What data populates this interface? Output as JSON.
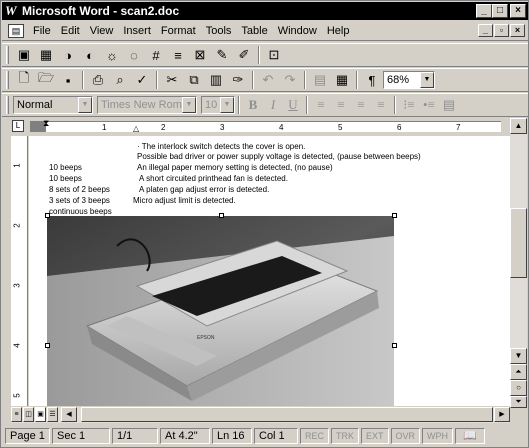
{
  "window": {
    "app_letter": "W",
    "title": "Microsoft Word - scan2.doc",
    "caption_buttons": [
      "_",
      "□",
      "×"
    ]
  },
  "menubar": {
    "items": [
      "File",
      "Edit",
      "View",
      "Insert",
      "Format",
      "Tools",
      "Table",
      "Window",
      "Help"
    ],
    "mdi_buttons": [
      "_",
      "▫",
      "×"
    ]
  },
  "toolbar_scan": {
    "icons": [
      "scan-icon",
      "picture-icon",
      "ocr-icon",
      "ocr-alt-icon",
      "brightness-icon",
      "contrast-icon",
      "crop-icon",
      "align-icon",
      "picture-frame-icon",
      "paint-icon",
      "pen-icon",
      "insert-picture-icon"
    ]
  },
  "toolbar_standard": {
    "zoom": "68%",
    "paragraph_mark": "¶"
  },
  "toolbar_formatting": {
    "style": "Normal",
    "font": "Times New Roman",
    "size": "10"
  },
  "ruler": {
    "numbers": [
      "1",
      "2",
      "3",
      "4",
      "5",
      "6",
      "7"
    ],
    "vertical_numbers": [
      "1",
      "2",
      "3",
      "4",
      "5"
    ]
  },
  "document": {
    "lines": [
      "· The interlock switch detects the cover is open.",
      "Possible bad driver or power supply voltage is detected, (pause between beeps)"
    ],
    "beep_table": [
      {
        "code": "10 beeps",
        "meaning": "An illegal paper memory setting is detected, (no pause)"
      },
      {
        "code": "10 beeps",
        "meaning": "A short circuited printhead fan is detected."
      },
      {
        "code": "8 sets of 2 beeps",
        "meaning": "A platen gap adjust error is detected."
      },
      {
        "code": "3 sets of 3 beeps",
        "meaning": "Micro adjust limit is detected."
      },
      {
        "code": "continuous beeps",
        "meaning": ""
      }
    ],
    "photo_caption": "EPSON"
  },
  "statusbar": {
    "page": "Page 1",
    "section": "Sec 1",
    "page_of": "1/1",
    "at": "At 4.2\"",
    "line": "Ln 16",
    "col": "Col 1",
    "flags": [
      "REC",
      "TRK",
      "EXT",
      "OVR",
      "WPH"
    ]
  },
  "colors": {
    "chrome": "#d4d0c8",
    "title_bar": "#000000"
  }
}
